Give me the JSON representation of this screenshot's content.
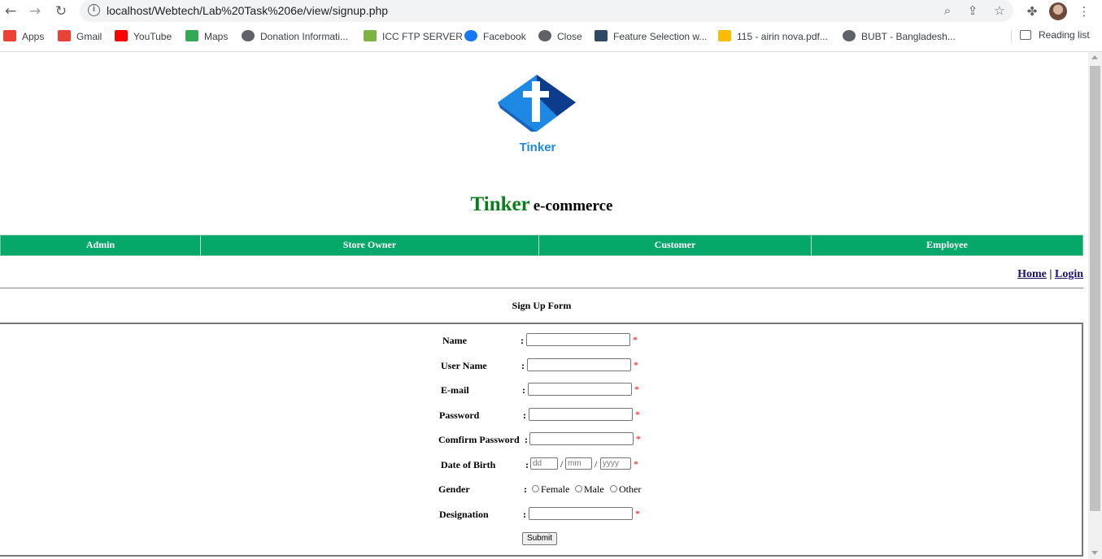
{
  "browser": {
    "url": "localhost/Webtech/Lab%20Task%206e/view/signup.php",
    "bookmarks": [
      {
        "label": "Apps",
        "icon": "apps-grid-icon",
        "color": "#ea4335"
      },
      {
        "label": "Gmail",
        "icon": "gmail-icon",
        "color": "#ea4335"
      },
      {
        "label": "YouTube",
        "icon": "youtube-icon",
        "color": "#ff0000"
      },
      {
        "label": "Maps",
        "icon": "maps-pin-icon",
        "color": "#34a853"
      },
      {
        "label": "Donation Informati...",
        "icon": "globe-icon",
        "color": "#5f6368"
      },
      {
        "label": "ICC FTP SERVER",
        "icon": "icc-leaf-icon",
        "color": "#7cb342"
      },
      {
        "label": "Facebook",
        "icon": "facebook-icon",
        "color": "#1877f2"
      },
      {
        "label": "Close",
        "icon": "globe-icon",
        "color": "#5f6368"
      },
      {
        "label": "Feature Selection w...",
        "icon": "tds-icon",
        "color": "#2e4a62"
      },
      {
        "label": "115 - airin nova.pdf...",
        "icon": "google-drive-icon",
        "color": "#fbbc04"
      },
      {
        "label": "BUBT - Bangladesh...",
        "icon": "globe-icon",
        "color": "#5f6368"
      }
    ],
    "reading_list": "Reading list"
  },
  "page": {
    "logo_text": "Tinker",
    "brand": "Tinker",
    "tagline": "e-commerce",
    "menu": [
      "Admin",
      "Store Owner",
      "Customer",
      "Employee"
    ],
    "links": {
      "home": "Home",
      "separator": "|",
      "login": "Login"
    },
    "form_title": "Sign Up Form",
    "fields": {
      "name": "Name",
      "username": "User Name",
      "email": "E-mail",
      "password": "Password",
      "confirm": "Comfirm Password",
      "dob": "Date of Birth",
      "gender": "Gender",
      "designation": "Designation"
    },
    "colon": ":",
    "required": "*",
    "dob_placeholders": {
      "day": "dd",
      "month": "mm",
      "year": "yyyy"
    },
    "dob_separator": "/",
    "gender_options": [
      "Female",
      "Male",
      "Other"
    ],
    "submit": "Submit"
  },
  "colors": {
    "menu_bg": "#06a86a",
    "brand_green": "#0b7d1a",
    "link": "#1a1170",
    "required": "#ee0000"
  }
}
